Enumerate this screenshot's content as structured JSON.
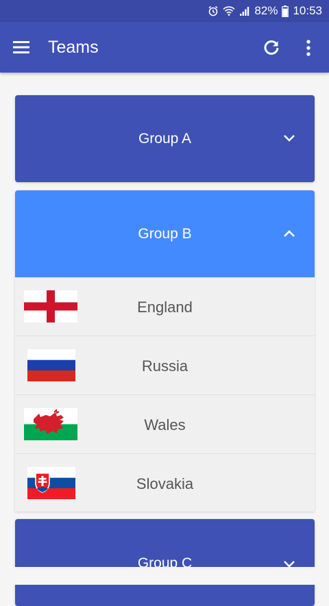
{
  "status_bar": {
    "battery_percent": "82%",
    "time": "10:53",
    "icons": [
      "alarm-icon",
      "wifi-icon",
      "signal-icon",
      "battery-icon"
    ]
  },
  "app_bar": {
    "title": "Teams",
    "icons": [
      "menu-icon",
      "refresh-icon",
      "more-vert-icon"
    ]
  },
  "colors": {
    "primary": "#3f51b5",
    "primary_dark": "#3a48a6",
    "expanded_accent": "#448aff",
    "list_background": "#f0f0f0",
    "team_text": "#555555"
  },
  "groups": [
    {
      "label": "Group A",
      "expanded": false
    },
    {
      "label": "Group B",
      "expanded": true,
      "teams": [
        {
          "name": "England",
          "flag": "england-flag-icon"
        },
        {
          "name": "Russia",
          "flag": "russia-flag-icon"
        },
        {
          "name": "Wales",
          "flag": "wales-flag-icon"
        },
        {
          "name": "Slovakia",
          "flag": "slovakia-flag-icon"
        }
      ]
    },
    {
      "label": "Group C",
      "expanded": false
    }
  ]
}
